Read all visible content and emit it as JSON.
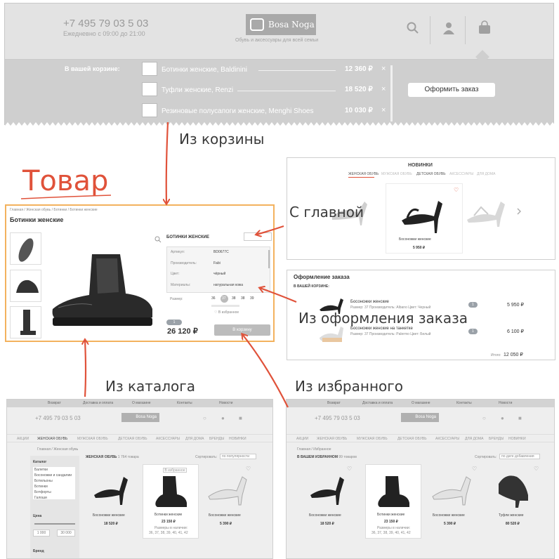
{
  "header": {
    "phone": "+7 495 79 03 5 03",
    "hours": "Ежедневно с 09:00 до 21:00",
    "logo_text": "Bosa Noga",
    "tagline": "Обувь и аксессуары для всей семьи"
  },
  "cart_dropdown": {
    "label": "В вашей корзине:",
    "items": [
      {
        "name": "Ботинки женские, Baldinini",
        "price": "12 360 ₽"
      },
      {
        "name": "Туфли женские, Renzi",
        "price": "18 520 ₽"
      },
      {
        "name": "Резиновые полусапоги женские, Menghi Shoes",
        "price": "10 030 ₽"
      }
    ],
    "remove_glyph": "×",
    "checkout_button": "Оформить заказ"
  },
  "annotations": {
    "from_cart": "Из корзины",
    "product": "Товар",
    "from_main": "С главной",
    "from_checkout": "Из оформления заказа",
    "from_catalog": "Из каталога",
    "from_favorites": "Из избранного"
  },
  "product": {
    "breadcrumb": "Главная / Женская обувь / Ботинки / Ботинки женские",
    "title": "Ботинки женские",
    "side_title": "БОТИНКИ ЖЕНСКИЕ",
    "specs": [
      {
        "label": "Артикул:",
        "value": "BD0677C"
      },
      {
        "label": "Производитель:",
        "value": "Fabi"
      },
      {
        "label": "Цвет:",
        "value": "чёрный"
      },
      {
        "label": "Материалы:",
        "value": "натуральная кожа"
      }
    ],
    "size_label": "Размер:",
    "sizes": [
      "36",
      "37",
      "38",
      "38",
      "39"
    ],
    "favorite_label": "В избранное",
    "qty": "1",
    "price": "26 120 ₽",
    "cart_button": "В корзину"
  },
  "new_arrivals": {
    "title": "НОВИНКИ",
    "tabs": [
      "ЖЕНСКАЯ ОБУВЬ",
      "МУЖСКАЯ ОБУВЬ",
      "ДЕТСКАЯ ОБУВЬ",
      "АКСЕССУАРЫ",
      "ДЛЯ ДОМА"
    ],
    "item_name": "Босоножки женские",
    "item_price": "5 950 ₽"
  },
  "checkout": {
    "title": "Оформление заказа",
    "cart_label": "В ВАШЕЙ КОРЗИНЕ:",
    "items": [
      {
        "name": "Босоножки женские",
        "details": "Размер: 37  Производитель: Albano  Цвет: Черный",
        "qty": "1",
        "price": "5 950 ₽"
      },
      {
        "name": "Босоножки женские на танкетке",
        "details": "Размер: 37  Производитель: Palermo  Цвет: Белый",
        "qty": "1",
        "price": "6 100 ₽"
      }
    ],
    "total_label": "Итого:",
    "total": "12 050 ₽"
  },
  "site_nav": [
    "Возврат",
    "Доставка и оплата",
    "О магазине",
    "Контакты",
    "Новости"
  ],
  "catalog_tabs": [
    "АКЦИИ",
    "ЖЕНСКАЯ ОБУВЬ",
    "МУЖСКАЯ ОБУВЬ",
    "ДЕТСКАЯ ОБУВЬ",
    "АКСЕССУАРЫ",
    "ДЛЯ ДОМА",
    "БРЕНДЫ",
    "НОВИНКИ"
  ],
  "catalog": {
    "breadcrumb": "Главная / Женская обувь",
    "heading": "ЖЕНСКАЯ ОБУВЬ",
    "count": "1 764 товара",
    "sort_label": "Сортировать:",
    "sort_value": "по популярности",
    "filter_title": "Каталог",
    "categories": [
      "Балетки",
      "Босоножки и сандалии",
      "Ботильоны",
      "Ботинки",
      "Ботфорты",
      "Галоши"
    ],
    "price_title": "Цена",
    "price_from": "1 000",
    "price_to": "30 000",
    "brand_title": "Бренд",
    "favorite_badge": "В избранное",
    "products": [
      {
        "name": "Босоножки женские",
        "price": "18 520 ₽"
      },
      {
        "name": "Ботинки женские",
        "price": "23 150 ₽",
        "sizes_label": "Размеры в наличии:",
        "sizes": "36, 37, 38, 39, 40, 41, 42"
      },
      {
        "name": "Босоножки женские",
        "price": "5 390 ₽"
      }
    ]
  },
  "favorites": {
    "breadcrumb": "Главная / Избранное",
    "heading": "В ВАШЕМ ИЗБРАННОМ",
    "count": "99 товаров",
    "sort_label": "Сортировать:",
    "sort_value": "по дате добавления",
    "products": [
      {
        "name": "Босоножки женские",
        "price": "18 520 ₽"
      },
      {
        "name": "Ботинки женские",
        "price": "23 150 ₽",
        "sizes_label": "Размеры в наличии:",
        "sizes": "36, 37, 38, 39, 40, 41, 42"
      },
      {
        "name": "Босоножки женские",
        "price": "5 390 ₽"
      },
      {
        "name": "Туфли женские",
        "price": "80 520 ₽"
      }
    ]
  },
  "colors": {
    "annotation_red": "#e0523a",
    "highlight_orange": "#f3b25e",
    "overlay_grey": "#d8d8d8"
  }
}
